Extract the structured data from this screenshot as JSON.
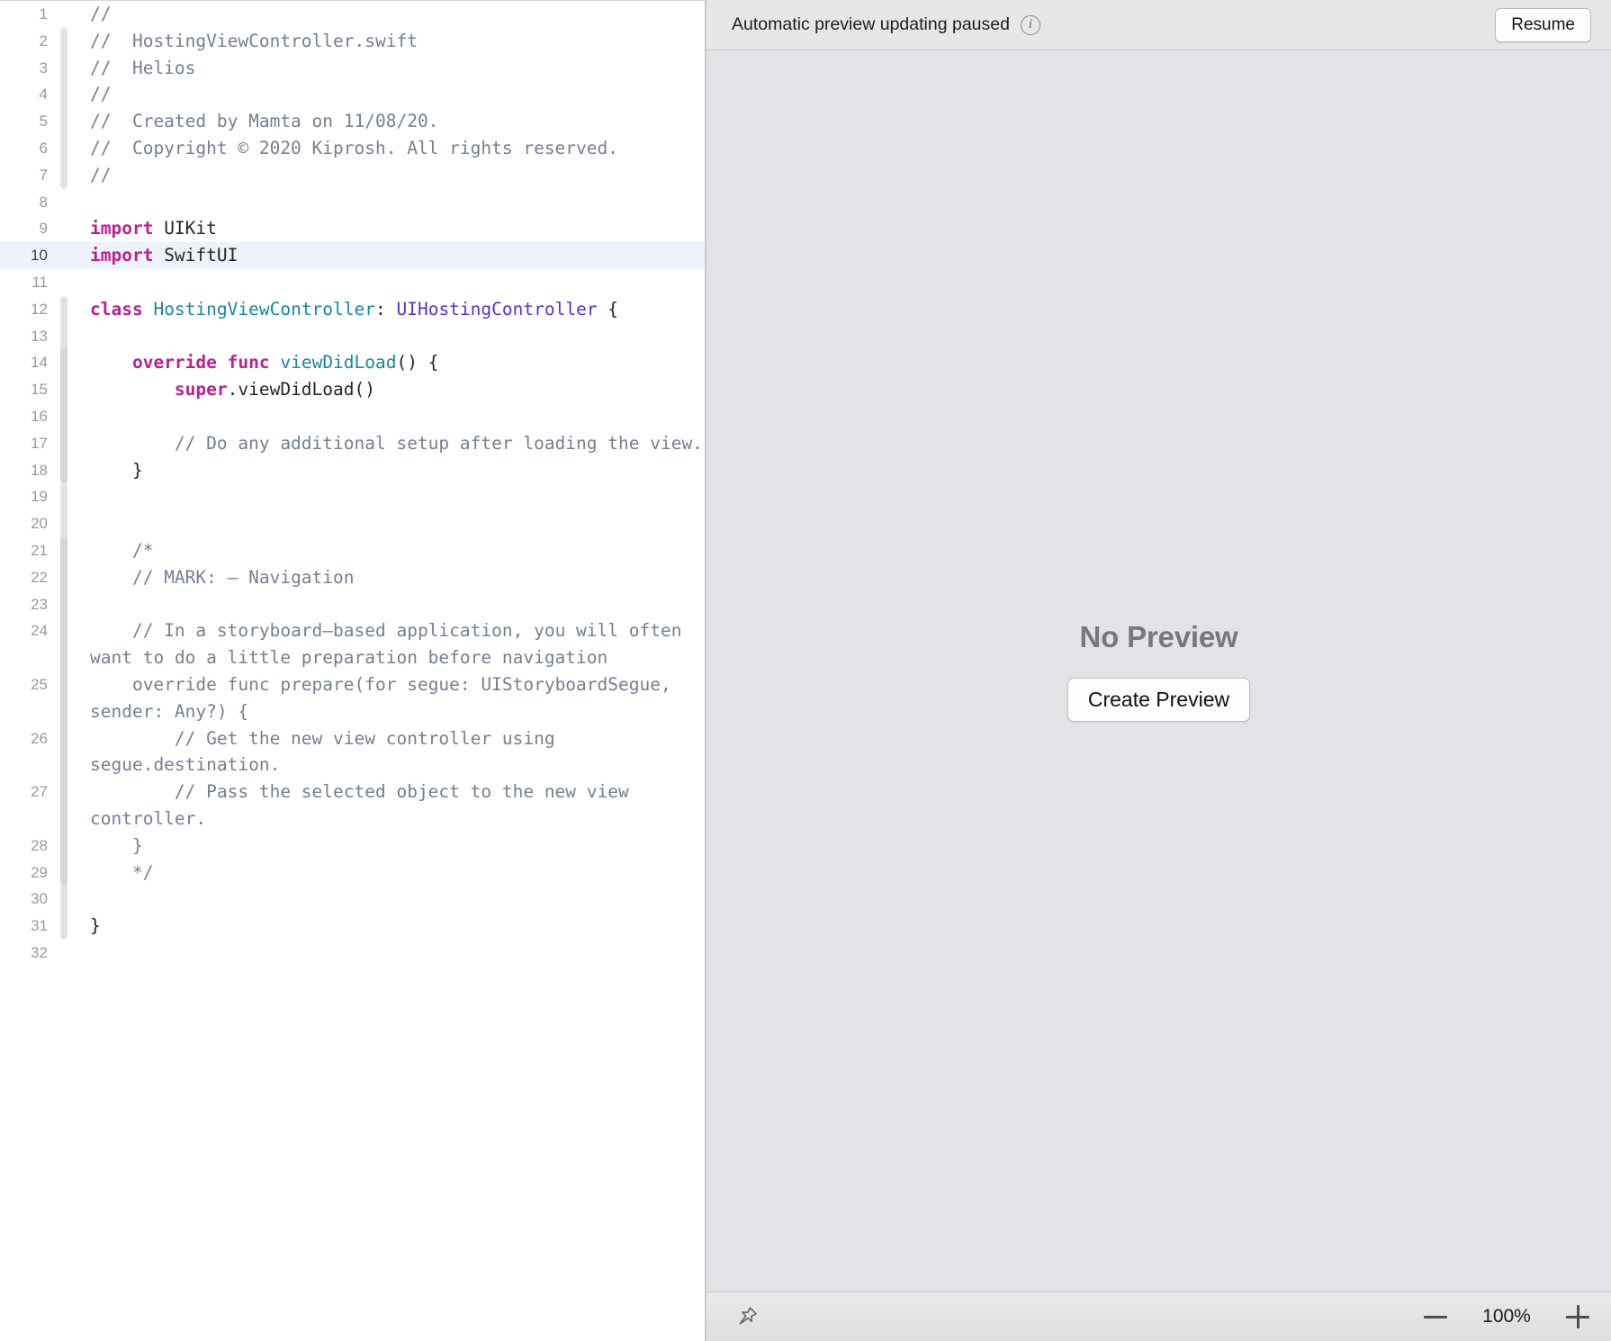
{
  "editor": {
    "current_line": 10,
    "lines": [
      {
        "n": "1",
        "fold": "none",
        "segments": [
          {
            "t": "//",
            "c": "cmt"
          }
        ]
      },
      {
        "n": "2",
        "fold": "top",
        "segments": [
          {
            "t": "//  HostingViewController.swift",
            "c": "cmt"
          }
        ]
      },
      {
        "n": "3",
        "fold": "mid",
        "segments": [
          {
            "t": "//  Helios",
            "c": "cmt"
          }
        ]
      },
      {
        "n": "4",
        "fold": "mid",
        "segments": [
          {
            "t": "//",
            "c": "cmt"
          }
        ]
      },
      {
        "n": "5",
        "fold": "mid",
        "segments": [
          {
            "t": "//  Created by Mamta on 11/08/20.",
            "c": "cmt"
          }
        ]
      },
      {
        "n": "6",
        "fold": "mid",
        "segments": [
          {
            "t": "//  Copyright © 2020 Kiprosh. All rights reserved.",
            "c": "cmt"
          }
        ]
      },
      {
        "n": "7",
        "fold": "bot",
        "segments": [
          {
            "t": "//",
            "c": "cmt"
          }
        ]
      },
      {
        "n": "8",
        "fold": "none",
        "segments": []
      },
      {
        "n": "9",
        "fold": "none",
        "segments": [
          {
            "t": "import",
            "c": "kw"
          },
          {
            "t": " UIKit",
            "c": "plain"
          }
        ]
      },
      {
        "n": "10",
        "fold": "none",
        "segments": [
          {
            "t": "import",
            "c": "kw"
          },
          {
            "t": " SwiftUI",
            "c": "plain"
          }
        ]
      },
      {
        "n": "11",
        "fold": "none",
        "segments": []
      },
      {
        "n": "12",
        "fold": "top",
        "segments": [
          {
            "t": "class",
            "c": "kw"
          },
          {
            "t": " ",
            "c": "plain"
          },
          {
            "t": "HostingViewController",
            "c": "type"
          },
          {
            "t": ": ",
            "c": "plain"
          },
          {
            "t": "UIHostingController",
            "c": "systype"
          },
          {
            "t": " {",
            "c": "plain"
          }
        ]
      },
      {
        "n": "13",
        "fold": "mid",
        "segments": []
      },
      {
        "n": "14",
        "fold": "mid2",
        "segments": [
          {
            "t": "    ",
            "c": "plain"
          },
          {
            "t": "override",
            "c": "kw"
          },
          {
            "t": " ",
            "c": "plain"
          },
          {
            "t": "func",
            "c": "kw"
          },
          {
            "t": " ",
            "c": "plain"
          },
          {
            "t": "viewDidLoad",
            "c": "fn"
          },
          {
            "t": "() {",
            "c": "plain"
          }
        ]
      },
      {
        "n": "15",
        "fold": "mid2",
        "segments": [
          {
            "t": "        ",
            "c": "plain"
          },
          {
            "t": "super",
            "c": "kw"
          },
          {
            "t": ".viewDidLoad()",
            "c": "plain"
          }
        ]
      },
      {
        "n": "16",
        "fold": "mid2",
        "segments": []
      },
      {
        "n": "17",
        "fold": "mid2",
        "segments": [
          {
            "t": "        // Do any additional setup after loading the view.",
            "c": "cmt"
          }
        ]
      },
      {
        "n": "18",
        "fold": "botmid",
        "segments": [
          {
            "t": "    }",
            "c": "plain"
          }
        ]
      },
      {
        "n": "19",
        "fold": "mid",
        "segments": []
      },
      {
        "n": "20",
        "fold": "mid",
        "segments": []
      },
      {
        "n": "21",
        "fold": "mid3",
        "segments": [
          {
            "t": "    /*",
            "c": "cmt"
          }
        ]
      },
      {
        "n": "22",
        "fold": "mid3",
        "segments": [
          {
            "t": "    // MARK: – Navigation",
            "c": "cmt"
          }
        ]
      },
      {
        "n": "23",
        "fold": "mid3",
        "segments": []
      },
      {
        "n": "24",
        "fold": "mid3",
        "segments": [
          {
            "t": "    // In a storyboard–based application, you will often want to do a little preparation before navigation",
            "c": "cmt"
          }
        ]
      },
      {
        "n": "25",
        "fold": "mid4",
        "segments": [
          {
            "t": "    override func prepare(for segue: UIStoryboardSegue, sender: Any?) {",
            "c": "cmt"
          }
        ]
      },
      {
        "n": "26",
        "fold": "mid4",
        "segments": [
          {
            "t": "        // Get the new view controller using segue.destination.",
            "c": "cmt"
          }
        ]
      },
      {
        "n": "27",
        "fold": "mid4",
        "segments": [
          {
            "t": "        // Pass the selected object to the new view controller.",
            "c": "cmt"
          }
        ]
      },
      {
        "n": "28",
        "fold": "mid4b",
        "segments": [
          {
            "t": "    }",
            "c": "cmt"
          }
        ]
      },
      {
        "n": "29",
        "fold": "bot2",
        "segments": [
          {
            "t": "    */",
            "c": "cmt"
          }
        ]
      },
      {
        "n": "30",
        "fold": "mid",
        "segments": []
      },
      {
        "n": "31",
        "fold": "bot",
        "segments": [
          {
            "t": "}",
            "c": "plain"
          }
        ]
      },
      {
        "n": "32",
        "fold": "none",
        "segments": []
      }
    ]
  },
  "preview": {
    "status_text": "Automatic preview updating paused",
    "info_icon_glyph": "i",
    "resume_label": "Resume",
    "no_preview_title": "No Preview",
    "create_preview_label": "Create Preview",
    "pin_icon_name": "pin-icon",
    "zoom_out_label": "−",
    "zoom_level": "100%",
    "zoom_in_label": "+"
  },
  "colors": {
    "keyword": "#b8228f",
    "type": "#1a859e",
    "system_type": "#5a32c4",
    "comment": "#75808f",
    "plain": "#262626",
    "current_line_bg": "#eef2fb",
    "preview_bg": "#e2e3e6",
    "header_bg": "#e7e7e7"
  }
}
